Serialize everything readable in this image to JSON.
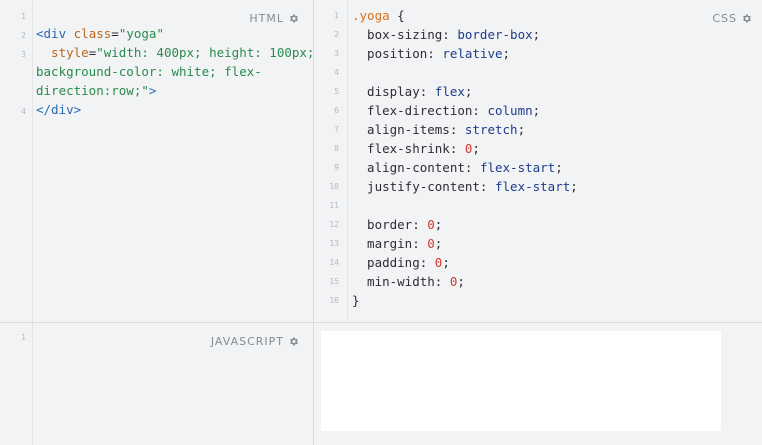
{
  "html_pane": {
    "label": "HTML",
    "line_numbers": [
      "1",
      "2",
      "3",
      "4"
    ],
    "lines": [
      {
        "parts": [
          {
            "t": "<div ",
            "c": "tag"
          },
          {
            "t": "class",
            "c": "attr"
          },
          {
            "t": "=",
            "c": "prop"
          },
          {
            "t": "\"yoga\"",
            "c": "str"
          }
        ]
      },
      {
        "parts": [
          {
            "t": "  style",
            "c": "attr"
          },
          {
            "t": "=",
            "c": "prop"
          },
          {
            "t": "\"width: 400px; height: 100px;",
            "c": "str"
          }
        ]
      },
      {
        "parts": [
          {
            "t": "background-color: white; flex-",
            "c": "str"
          }
        ]
      },
      {
        "parts": [
          {
            "t": "direction:row;\"",
            "c": "str"
          },
          {
            "t": ">",
            "c": "tag"
          }
        ]
      },
      {
        "parts": [
          {
            "t": "</div>",
            "c": "tag"
          }
        ]
      }
    ]
  },
  "css_pane": {
    "label": "CSS",
    "line_numbers": [
      "1",
      "2",
      "3",
      "4",
      "5",
      "6",
      "7",
      "8",
      "9",
      "10",
      "11",
      "12",
      "13",
      "14",
      "15",
      "16"
    ],
    "lines": [
      {
        "parts": [
          {
            "t": ".yoga",
            "c": "sel"
          },
          {
            "t": " {",
            "c": "prop"
          }
        ]
      },
      {
        "parts": [
          {
            "t": "  box-sizing: ",
            "c": "prop"
          },
          {
            "t": "border-box",
            "c": "val"
          },
          {
            "t": ";",
            "c": "prop"
          }
        ]
      },
      {
        "parts": [
          {
            "t": "  position: ",
            "c": "prop"
          },
          {
            "t": "relative",
            "c": "val"
          },
          {
            "t": ";",
            "c": "prop"
          }
        ]
      },
      {
        "parts": []
      },
      {
        "parts": [
          {
            "t": "  display: ",
            "c": "prop"
          },
          {
            "t": "flex",
            "c": "val"
          },
          {
            "t": ";",
            "c": "prop"
          }
        ]
      },
      {
        "parts": [
          {
            "t": "  flex-direction: ",
            "c": "prop"
          },
          {
            "t": "column",
            "c": "val"
          },
          {
            "t": ";",
            "c": "prop"
          }
        ]
      },
      {
        "parts": [
          {
            "t": "  align-items: ",
            "c": "prop"
          },
          {
            "t": "stretch",
            "c": "val"
          },
          {
            "t": ";",
            "c": "prop"
          }
        ]
      },
      {
        "parts": [
          {
            "t": "  flex-shrink: ",
            "c": "prop"
          },
          {
            "t": "0",
            "c": "num"
          },
          {
            "t": ";",
            "c": "prop"
          }
        ]
      },
      {
        "parts": [
          {
            "t": "  align-content: ",
            "c": "prop"
          },
          {
            "t": "flex-start",
            "c": "val"
          },
          {
            "t": ";",
            "c": "prop"
          }
        ]
      },
      {
        "parts": [
          {
            "t": "  justify-content: ",
            "c": "prop"
          },
          {
            "t": "flex-start",
            "c": "val"
          },
          {
            "t": ";",
            "c": "prop"
          }
        ]
      },
      {
        "parts": []
      },
      {
        "parts": [
          {
            "t": "  border: ",
            "c": "prop"
          },
          {
            "t": "0",
            "c": "num"
          },
          {
            "t": ";",
            "c": "prop"
          }
        ]
      },
      {
        "parts": [
          {
            "t": "  margin: ",
            "c": "prop"
          },
          {
            "t": "0",
            "c": "num"
          },
          {
            "t": ";",
            "c": "prop"
          }
        ]
      },
      {
        "parts": [
          {
            "t": "  padding: ",
            "c": "prop"
          },
          {
            "t": "0",
            "c": "num"
          },
          {
            "t": ";",
            "c": "prop"
          }
        ]
      },
      {
        "parts": [
          {
            "t": "  min-width: ",
            "c": "prop"
          },
          {
            "t": "0",
            "c": "num"
          },
          {
            "t": ";",
            "c": "prop"
          }
        ]
      },
      {
        "parts": [
          {
            "t": "}",
            "c": "prop"
          }
        ]
      }
    ]
  },
  "js_pane": {
    "label": "JAVASCRIPT",
    "line_numbers": [
      "1"
    ]
  },
  "icons": {
    "pane_settings": "gear-icon"
  },
  "colors": {
    "background": "#f2f3f4",
    "tag": "#2a6bb2",
    "attr": "#b86a1e",
    "string": "#2a8a4e",
    "selector": "#d9731a",
    "value": "#1d3d8c",
    "number": "#d1392f"
  }
}
